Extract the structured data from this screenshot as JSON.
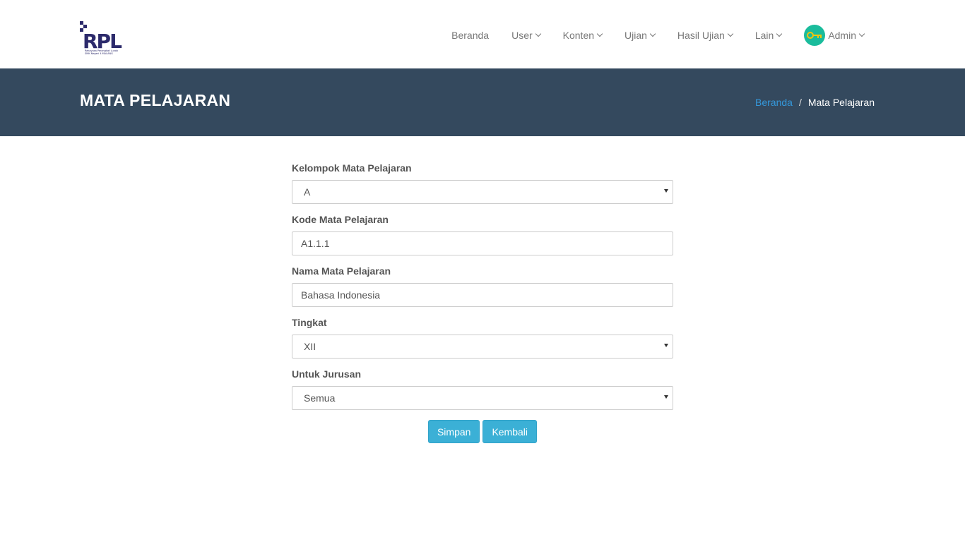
{
  "logo": {
    "text": "RPL",
    "tagline_line1": "Rekayasa Perangkat Lunak",
    "tagline_line2": "SMK Negeri 4 MALANG"
  },
  "nav": {
    "beranda": "Beranda",
    "user": "User",
    "konten": "Konten",
    "ujian": "Ujian",
    "hasil_ujian": "Hasil Ujian",
    "lain": "Lain",
    "admin": "Admin"
  },
  "banner": {
    "title": "MATA PELAJARAN",
    "breadcrumb_home": "Beranda",
    "breadcrumb_sep": "/",
    "breadcrumb_current": "Mata Pelajaran"
  },
  "form": {
    "kelompok_label": "Kelompok Mata Pelajaran",
    "kelompok_value": "A",
    "kode_label": "Kode Mata Pelajaran",
    "kode_value": "A1.1.1",
    "nama_label": "Nama Mata Pelajaran",
    "nama_value": "Bahasa Indonesia",
    "tingkat_label": "Tingkat",
    "tingkat_value": "XII",
    "jurusan_label": "Untuk Jurusan",
    "jurusan_value": "Semua",
    "simpan": "Simpan",
    "kembali": "Kembali"
  },
  "colors": {
    "banner_bg": "#34495e",
    "button": "#3bb0d6",
    "link": "#3498db",
    "avatar": "#1abc9c"
  }
}
